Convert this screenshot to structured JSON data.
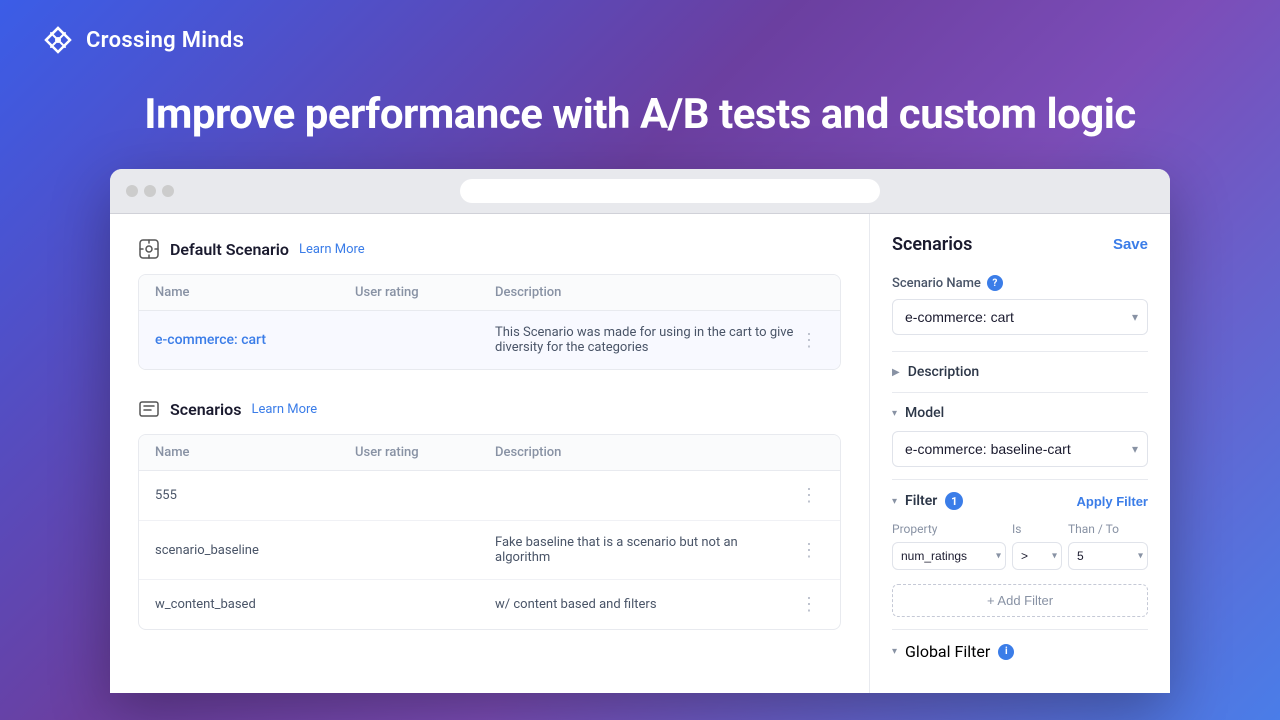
{
  "brand": {
    "name": "Crossing Minds",
    "logo_alt": "Crossing Minds Logo"
  },
  "hero": {
    "title": "Improve performance with A/B tests and custom logic"
  },
  "browser": {
    "url_placeholder": ""
  },
  "default_scenario": {
    "section_title": "Default Scenario",
    "learn_more": "Learn More",
    "columns": [
      "Name",
      "User rating",
      "Description"
    ],
    "rows": [
      {
        "name": "e-commerce: cart",
        "user_rating": "",
        "description": "This Scenario was made for using in the cart to give diversity for the categories"
      }
    ]
  },
  "scenarios": {
    "section_title": "Scenarios",
    "learn_more": "Learn More",
    "columns": [
      "Name",
      "User rating",
      "Description"
    ],
    "rows": [
      {
        "name": "555",
        "user_rating": "",
        "description": ""
      },
      {
        "name": "scenario_baseline",
        "user_rating": "",
        "description": "Fake baseline that is a scenario but not an algorithm"
      },
      {
        "name": "w_content_based",
        "user_rating": "",
        "description": "w/ content based and filters"
      }
    ]
  },
  "right_panel": {
    "title": "Scenarios",
    "save_label": "Save",
    "scenario_name_label": "Scenario Name",
    "scenario_name_info": "?",
    "scenario_name_value": "e-commerce: cart",
    "description_label": "Description",
    "model_label": "Model",
    "model_value": "e-commerce: baseline-cart",
    "filter_label": "Filter",
    "filter_count": "1",
    "apply_filter_label": "Apply Filter",
    "filter_columns": {
      "property": "Property",
      "is": "Is",
      "than_to": "Than / To"
    },
    "filter_row": {
      "property": "num_ratings",
      "is": ">",
      "value": "5"
    },
    "add_filter_label": "+ Add Filter",
    "global_filter_label": "Global Filter",
    "global_filter_info": "i"
  }
}
